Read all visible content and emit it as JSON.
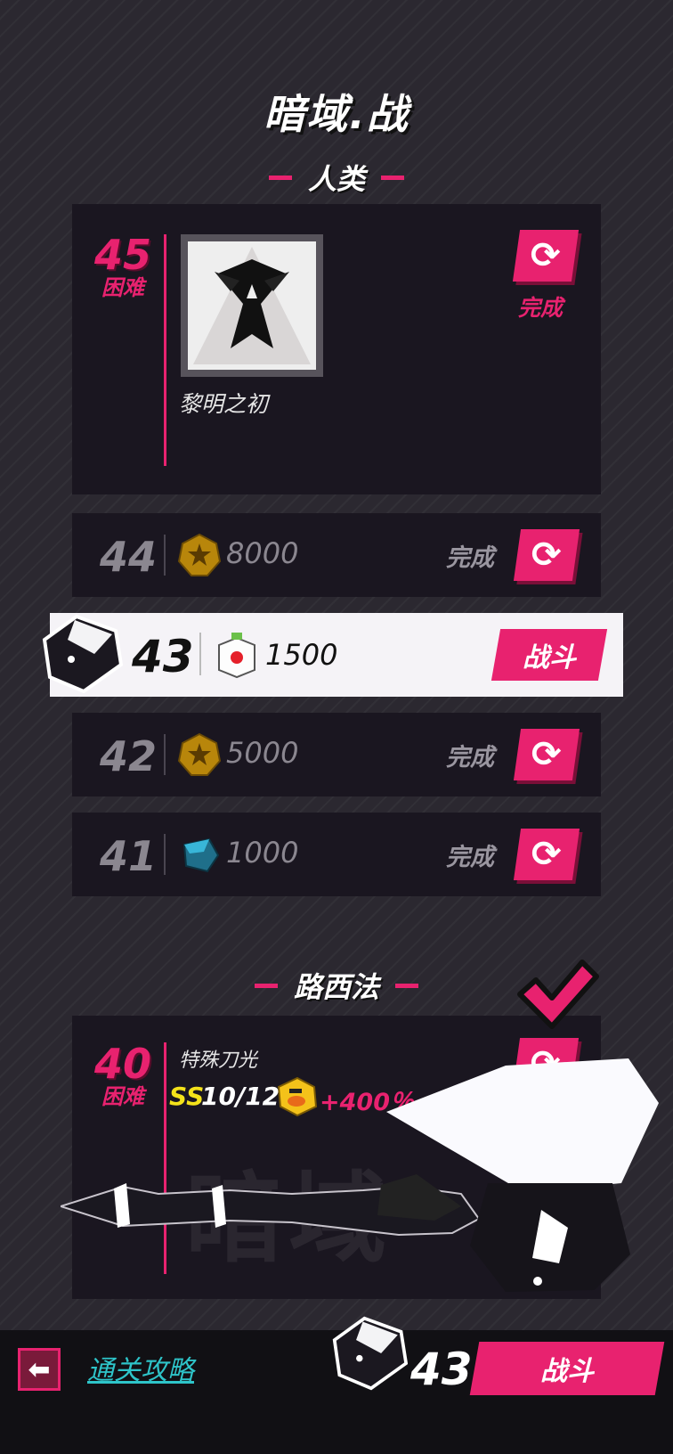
{
  "title": "暗域.战",
  "section1": {
    "label": "人类"
  },
  "boss45": {
    "number": "45",
    "difficulty": "困难",
    "name": "黎明之初",
    "status": "完成"
  },
  "stages": [
    {
      "number": "44",
      "reward_icon": "gold-star-coin-icon",
      "amount": "8000",
      "status": "完成"
    },
    {
      "number": "43",
      "reward_icon": "cube-capsule-icon",
      "amount": "1500",
      "action": "战斗"
    },
    {
      "number": "42",
      "reward_icon": "gold-star-coin-icon",
      "amount": "5000",
      "status": "完成"
    },
    {
      "number": "41",
      "reward_icon": "blue-gem-icon",
      "amount": "1000",
      "status": "完成"
    }
  ],
  "section2": {
    "label": "路西法"
  },
  "boss40": {
    "number": "40",
    "difficulty": "困难",
    "skill": "特殊刀光",
    "rank": "SS",
    "progress": "10/12",
    "bonus": "+400％",
    "watermark": "暗域"
  },
  "bottom": {
    "back_icon": "back-arrow-icon",
    "guide": "通关攻略",
    "level": "43",
    "action": "战斗"
  },
  "colors": {
    "accent": "#e8226f",
    "panel": "#1a1620",
    "background": "#2b2830",
    "link": "#2ec4c9",
    "rank": "#f4e21a"
  }
}
